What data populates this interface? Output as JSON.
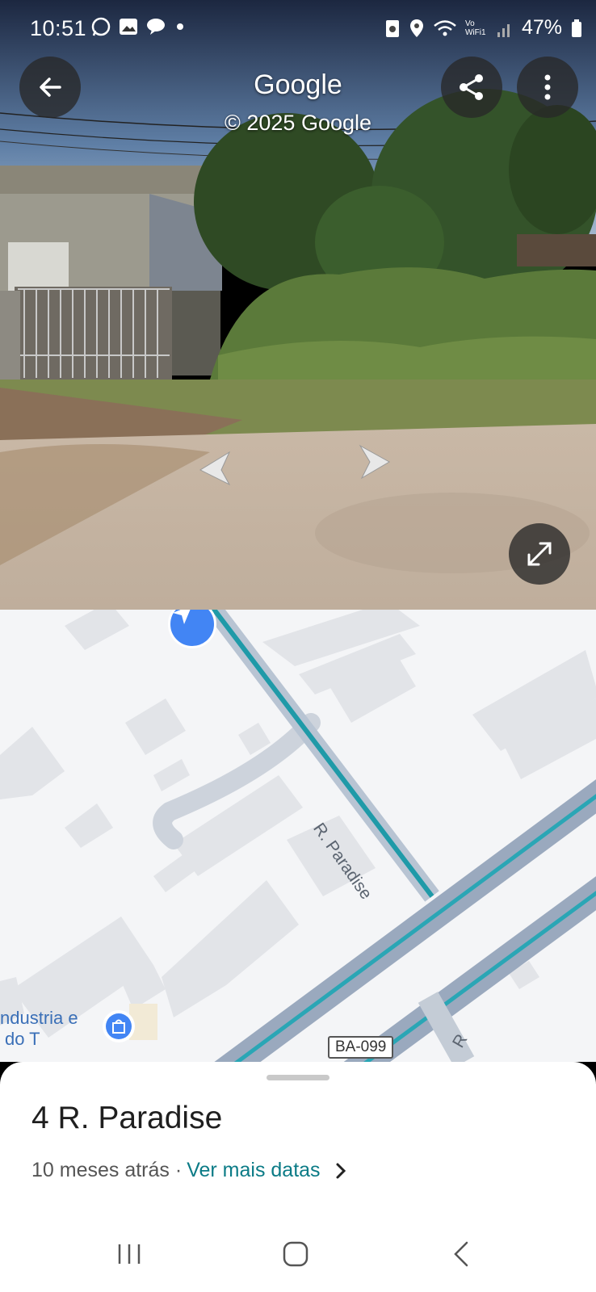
{
  "status_bar": {
    "time": "10:51",
    "left_icons": [
      "whatsapp-icon",
      "gallery-icon",
      "chat-icon",
      "dot-icon"
    ],
    "right_icons": [
      "recycle-icon",
      "location-icon",
      "wifi-icon",
      "signal-icon",
      "battery-icon"
    ],
    "vowifi_label": "Vo WiFi1",
    "battery": "47%"
  },
  "street_view": {
    "title": "Google",
    "copyright": "© 2025 Google",
    "buttons": [
      "back",
      "share",
      "more",
      "expand"
    ]
  },
  "map": {
    "street_label": "R. Paradise",
    "poi_label_line1": "ndustria e",
    "poi_label_line2": "do T",
    "route_badge": "BA-099",
    "partial_label": "R"
  },
  "sheet": {
    "title": "4 R. Paradise",
    "date_text": "10 meses atrás ·",
    "more_dates_link": "Ver mais datas"
  },
  "nav_bar": [
    "recents",
    "home",
    "back"
  ]
}
